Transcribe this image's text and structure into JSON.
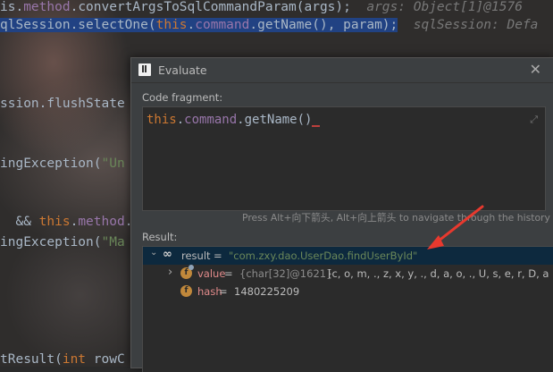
{
  "editor": {
    "line1_code_a": "is.",
    "line1_field": "method",
    "line1_code_b": ".convertArgsToSqlCommandParam(args);",
    "line1_hint": "args: Object[1]@1576",
    "line2_code_a": "qlSession.selectOne(",
    "line2_kw": "this",
    "line2_code_b": ".",
    "line2_field": "command",
    "line2_code_c": ".getName()",
    "line2_code_d": ", param);",
    "line2_hint": "sqlSession: Defa",
    "line3": "ssion.flushState",
    "line4_a": "ingException(",
    "line4_str": "\"Un",
    "line5_a": "&& ",
    "line5_kw": "this",
    "line5_b": ".",
    "line5_field": "method",
    "line5_c": ".",
    "line6_a": "ingException(",
    "line6_str": "\"Ma",
    "line7_a": "tResult(",
    "line7_kw": "int",
    "line7_b": " rowC"
  },
  "dialog": {
    "title": "Evaluate",
    "close": "✕",
    "fragment_label": "Code fragment:",
    "code_kw": "this",
    "code_dot": ".",
    "code_field": "command",
    "code_rest": ".getName()",
    "expand_icon": "⤢",
    "help": "Press Alt+向下箭头, Alt+向上箭头 to navigate through the history",
    "result_label": "Result:",
    "result": {
      "toggle": "⌄",
      "icon": "∞",
      "name": "result",
      "eq": " = ",
      "value": "\"com.zxy.dao.UserDao.findUserById\""
    },
    "children": [
      {
        "toggle": "›",
        "icon": "f",
        "name": "value",
        "eq": " = ",
        "type": "{char[32]@1621}",
        "value": "[c, o, m, ., z, x, y, ., d, a, o, ., U, s, e, r, D, a"
      },
      {
        "icon": "f",
        "name": "hash",
        "eq": " = ",
        "value": "1480225209"
      }
    ]
  },
  "colors": {
    "arrow": "#e8392e",
    "keyword": "#cc7832",
    "field": "#9876aa",
    "string": "#6a8759",
    "selection": "#214283"
  },
  "icons": [
    "intellij-icon",
    "close-icon",
    "expand-icon",
    "watch-icon",
    "field-icon",
    "red-arrow"
  ]
}
